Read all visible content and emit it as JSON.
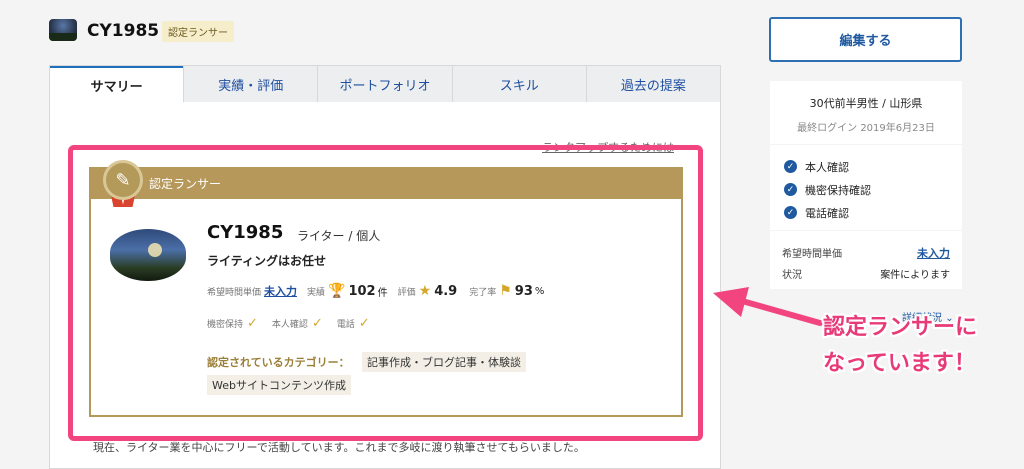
{
  "header": {
    "username": "CY1985",
    "badge": "認定ランサー"
  },
  "tabs": [
    {
      "label": "サマリー",
      "active": true
    },
    {
      "label": "実績・評価",
      "active": false
    },
    {
      "label": "ポートフォリオ",
      "active": false
    },
    {
      "label": "スキル",
      "active": false
    },
    {
      "label": "過去の提案",
      "active": false
    }
  ],
  "main": {
    "top_link": "ランクアップするためには",
    "bottom_text": "現在、ライター業を中心にフリーで活動しています。これまで多岐に渡り執筆させてもらいました。"
  },
  "card": {
    "header": "認定ランサー",
    "name": "CY1985",
    "role": "ライター / 個人",
    "tagline": "ライティングはお任せ",
    "stats": {
      "rate_label": "希望時間単価",
      "rate_value": "未入力",
      "works_label": "実績",
      "works_value": "102",
      "works_unit": "件",
      "rating_label": "評価",
      "rating_value": "4.9",
      "completion_label": "完了率",
      "completion_value": "93",
      "completion_unit": "%"
    },
    "verifications": [
      "機密保持",
      "本人確認",
      "電話"
    ],
    "category_label": "認定されているカテゴリー：",
    "categories": [
      "記事作成・ブログ記事・体験談",
      "Webサイトコンテンツ作成"
    ]
  },
  "sidebar": {
    "edit_button": "編集する",
    "profile": "30代前半男性 / 山形県",
    "last_login": "最終ログイン 2019年6月23日",
    "verifications": [
      "本人確認",
      "機密保持確認",
      "電話確認"
    ],
    "rate_label": "希望時間単価",
    "rate_value": "未入力",
    "status_label": "状況",
    "status_value": "案件によります",
    "detail_link": "詳細状況"
  },
  "annotation": {
    "line1": "認定ランサーに",
    "line2": "なっています！",
    "color": "#e83a78"
  }
}
